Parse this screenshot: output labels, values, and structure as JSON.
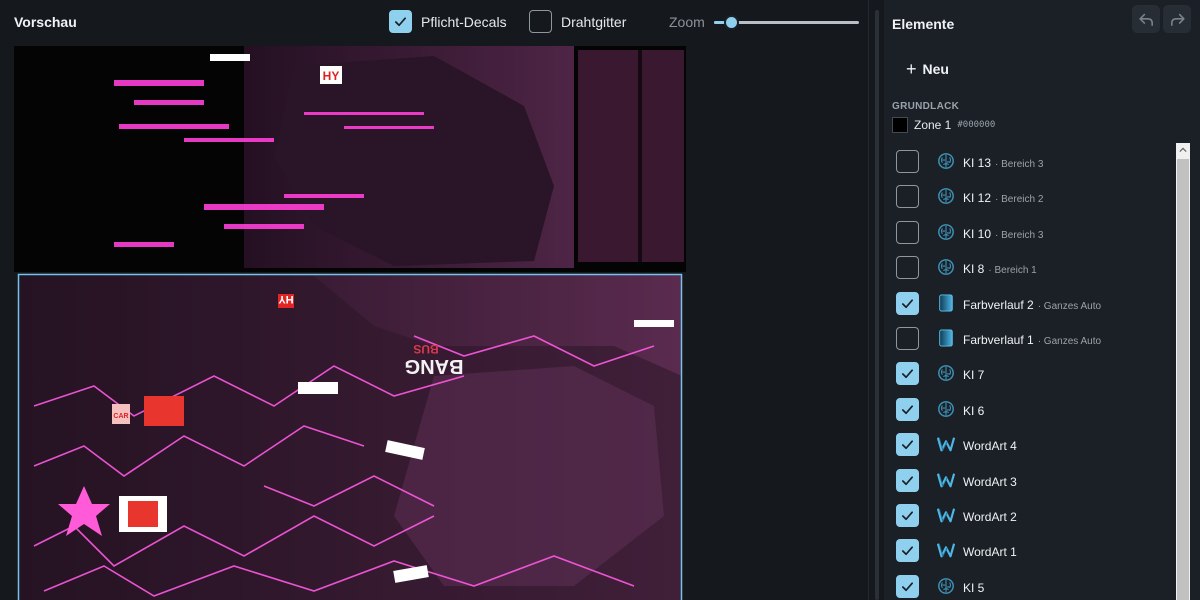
{
  "preview": {
    "title": "Vorschau",
    "mandatory_decals": {
      "label": "Pflicht-Decals",
      "checked": true
    },
    "wireframe": {
      "label": "Drahtgitter",
      "checked": false
    },
    "zoom": {
      "label": "Zoom",
      "value": 0.12
    }
  },
  "panel": {
    "title": "Elemente",
    "new_label": "Neu",
    "base_section": "GRUNDLACK",
    "base": {
      "name": "Zone 1",
      "hex": "#000000"
    },
    "items": [
      {
        "name": "KI 13",
        "sub": "· Bereich 3",
        "checked": false,
        "icon": "brain-icon"
      },
      {
        "name": "KI 12",
        "sub": "· Bereich 2",
        "checked": false,
        "icon": "brain-icon"
      },
      {
        "name": "KI 10",
        "sub": "· Bereich 3",
        "checked": false,
        "icon": "brain-icon"
      },
      {
        "name": "KI 8",
        "sub": "· Bereich 1",
        "checked": false,
        "icon": "brain-icon"
      },
      {
        "name": "Farbverlauf 2",
        "sub": "· Ganzes Auto",
        "checked": true,
        "icon": "gradient-icon"
      },
      {
        "name": "Farbverlauf 1",
        "sub": "· Ganzes Auto",
        "checked": false,
        "icon": "gradient-icon"
      },
      {
        "name": "KI 7",
        "sub": "",
        "checked": true,
        "icon": "brain-icon"
      },
      {
        "name": "KI 6",
        "sub": "",
        "checked": true,
        "icon": "brain-icon"
      },
      {
        "name": "WordArt 4",
        "sub": "",
        "checked": true,
        "icon": "wordart-icon"
      },
      {
        "name": "WordArt 3",
        "sub": "",
        "checked": true,
        "icon": "wordart-icon"
      },
      {
        "name": "WordArt 2",
        "sub": "",
        "checked": true,
        "icon": "wordart-icon"
      },
      {
        "name": "WordArt 1",
        "sub": "",
        "checked": true,
        "icon": "wordart-icon"
      },
      {
        "name": "KI 5",
        "sub": "",
        "checked": true,
        "icon": "brain-icon"
      }
    ]
  },
  "texture": {
    "decal_hy_top": "HY",
    "decal_hy_bottom": "HY",
    "decal_bang": "BANG",
    "decal_bus": "BUS",
    "decal_car": "CAR"
  },
  "colors": {
    "accent": "#8fd0ef",
    "body_purple": "#4a2340",
    "neon_pink": "#ff3fd8"
  }
}
